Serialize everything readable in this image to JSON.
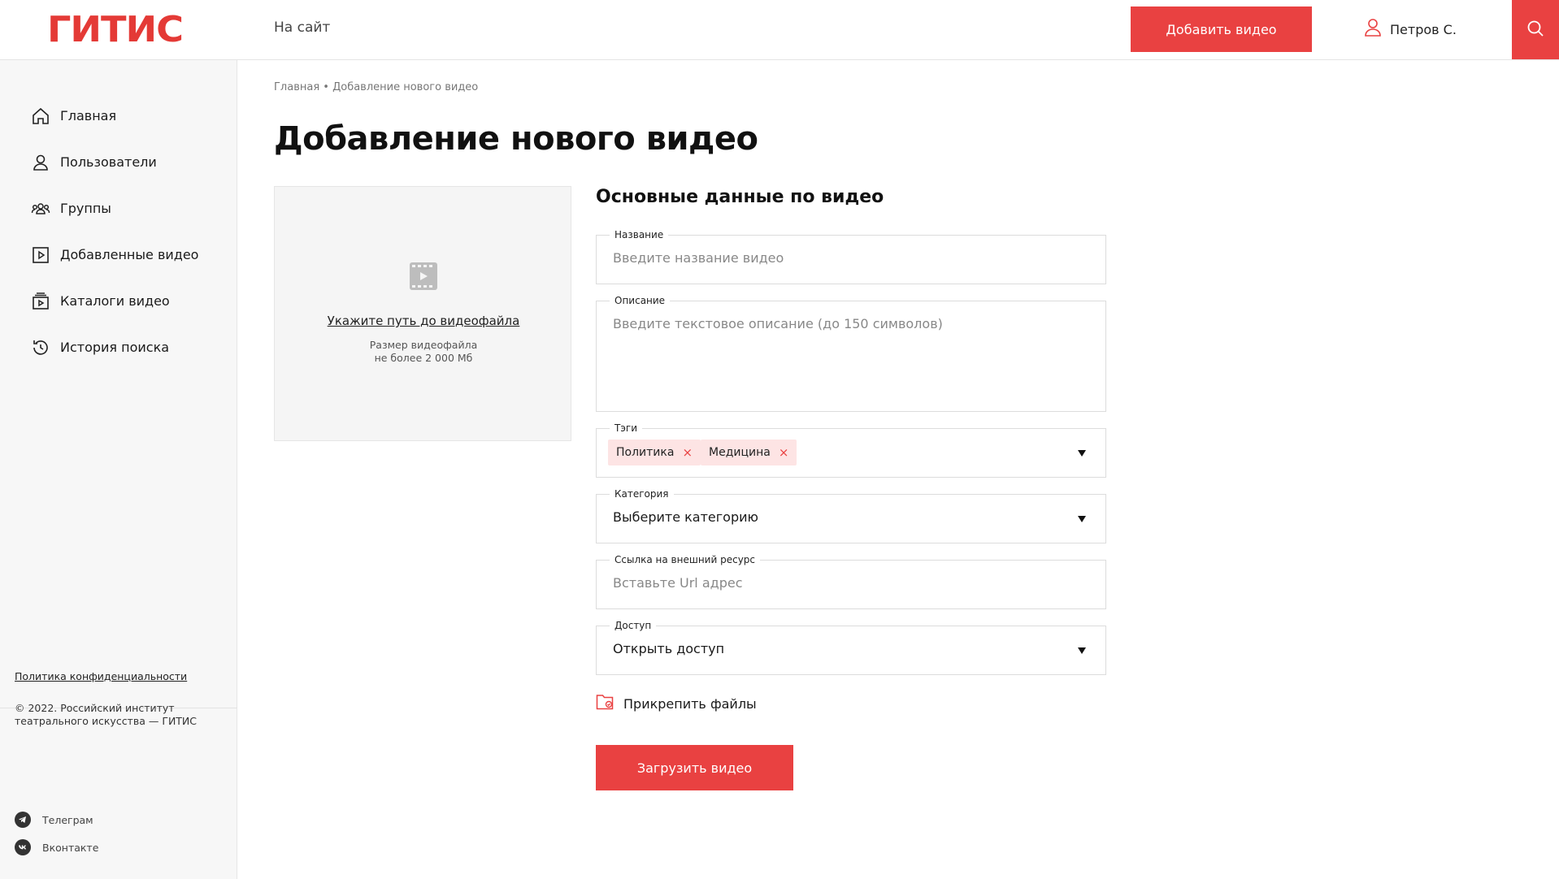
{
  "header": {
    "logo": "ГИТИС",
    "to_site": "На сайт",
    "add_video": "Добавить видео",
    "user_name": "Петров С."
  },
  "sidebar": {
    "items": [
      {
        "label": "Главная",
        "icon": "home-icon"
      },
      {
        "label": "Пользователи",
        "icon": "user-icon"
      },
      {
        "label": "Группы",
        "icon": "group-icon"
      },
      {
        "label": "Добавленные видео",
        "icon": "play-square-icon"
      },
      {
        "label": "Каталоги видео",
        "icon": "catalog-icon"
      },
      {
        "label": "История поиска",
        "icon": "history-icon"
      }
    ],
    "privacy": "Политика конфиденциальности",
    "copyright": "© 2022. Российский институт театрального искусства — ГИТИС",
    "social": [
      {
        "label": "Телеграм",
        "icon": "telegram-icon"
      },
      {
        "label": "Вконтакте",
        "icon": "vk-icon"
      }
    ]
  },
  "main": {
    "breadcrumb": "Главная • Добавление нового видео",
    "title": "Добавление нового видео",
    "upload": {
      "link": "Укажите путь до видеофайла",
      "hint_line1": "Размер видеофайла",
      "hint_line2": "не более 2 000 Мб"
    },
    "form": {
      "section_title": "Основные данные по видео",
      "name": {
        "label": "Название",
        "placeholder": "Введите название видео"
      },
      "description": {
        "label": "Описание",
        "placeholder": "Введите текстовое описание (до 150 символов)"
      },
      "tags": {
        "label": "Тэги",
        "items": [
          "Политика",
          "Медицина"
        ],
        "remove": "×"
      },
      "category": {
        "label": "Категория",
        "value": "Выберите категорию"
      },
      "link": {
        "label": "Ссылка на внешний ресурс",
        "placeholder": "Вставьте Url адрес"
      },
      "access": {
        "label": "Доступ",
        "value": "Открыть доступ"
      },
      "attach": "Прикрепить файлы",
      "submit": "Загрузить видео"
    }
  },
  "colors": {
    "accent": "#e94141",
    "tag_bg": "#fde4e4",
    "sidebar_bg": "#f7f7f7"
  }
}
